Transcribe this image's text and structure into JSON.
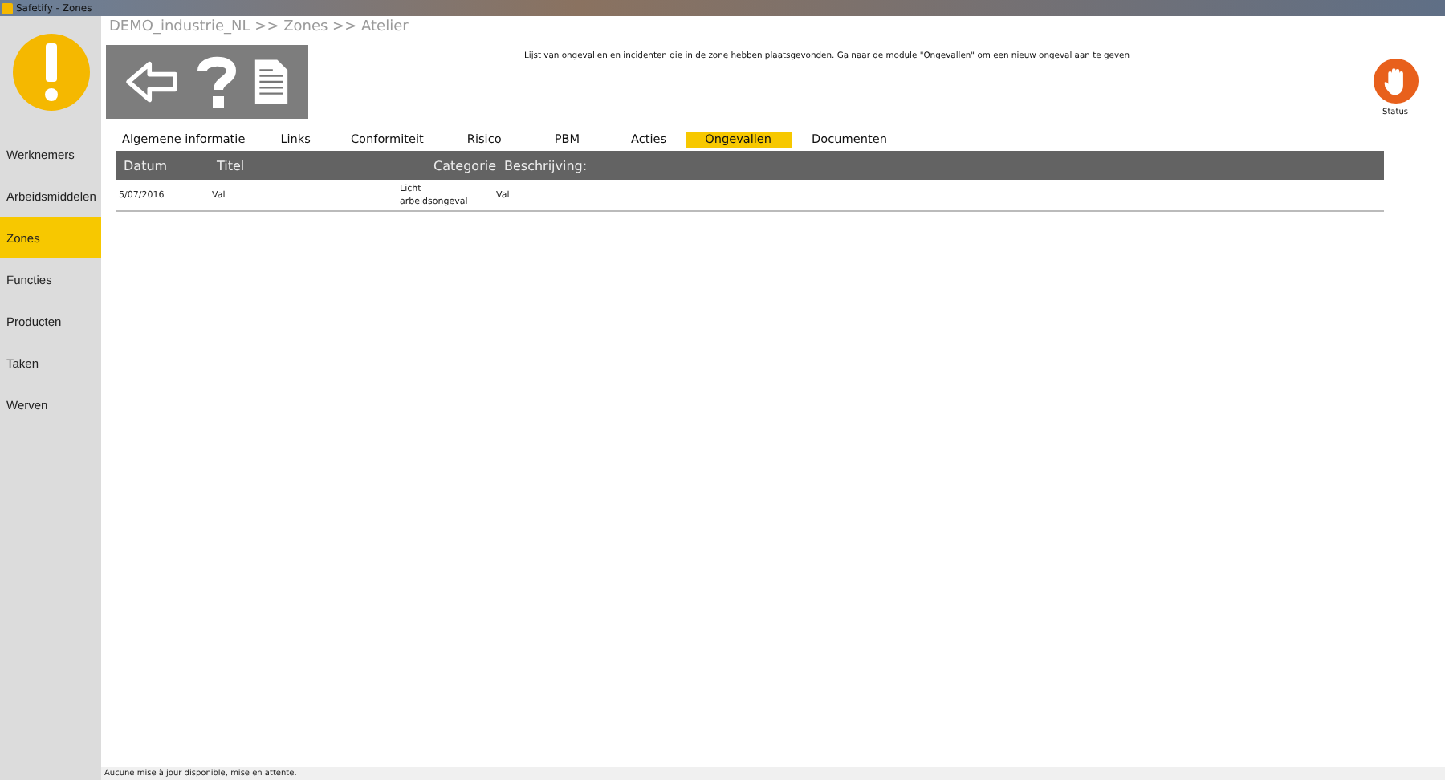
{
  "window": {
    "title": "Safetify - Zones"
  },
  "sidebar": {
    "items": [
      {
        "label": "Werknemers",
        "selected": false
      },
      {
        "label": "Arbeidsmiddelen",
        "selected": false
      },
      {
        "label": "Zones",
        "selected": true
      },
      {
        "label": "Functies",
        "selected": false
      },
      {
        "label": "Producten",
        "selected": false
      },
      {
        "label": "Taken",
        "selected": false
      },
      {
        "label": "Werven",
        "selected": false
      }
    ]
  },
  "breadcrumb": "DEMO_industrie_NL >> Zones >> Atelier",
  "info_text": "Lijst van ongevallen en incidenten die in de zone hebben plaatsgevonden. Ga naar de module \"Ongevallen\" om een nieuw ongeval aan te geven",
  "status": {
    "label": "Status"
  },
  "tabs": [
    {
      "label": "Algemene informatie",
      "selected": false
    },
    {
      "label": "Links",
      "selected": false
    },
    {
      "label": "Conformiteit",
      "selected": false
    },
    {
      "label": "Risico",
      "selected": false
    },
    {
      "label": "PBM",
      "selected": false
    },
    {
      "label": "Acties",
      "selected": false
    },
    {
      "label": "Ongevallen",
      "selected": true
    },
    {
      "label": "Documenten",
      "selected": false
    }
  ],
  "table": {
    "columns": [
      "Datum",
      "Titel",
      "Categorie",
      "Beschrijving:"
    ],
    "rows": [
      [
        "5/07/2016",
        "Val",
        "Licht arbeidsongeval",
        "Val"
      ]
    ]
  },
  "status_bar": "Aucune mise à jour disponible, mise en attente."
}
